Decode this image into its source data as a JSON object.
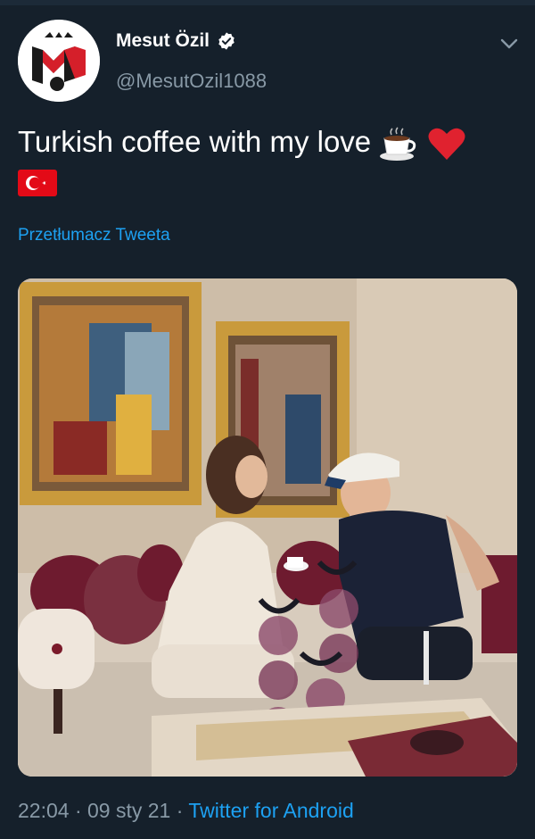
{
  "author": {
    "display_name": "Mesut Özil",
    "handle": "@MesutOzil1088",
    "verified": true,
    "avatar_icon": "m10-logo-icon"
  },
  "tweet": {
    "text": "Turkish coffee with my love",
    "emojis": [
      "coffee-icon",
      "red-heart-icon",
      "turkish-flag-icon"
    ],
    "translate_link": "Przetłumacz Tweeta",
    "time": "22:04",
    "separator": "·",
    "date": "09 sty 21",
    "source": "Twitter for Android"
  },
  "colors": {
    "background": "#15202b",
    "secondary_text": "#8899a6",
    "link": "#1da1f2",
    "heart": "#e0222f",
    "flag": "#e30a17"
  }
}
